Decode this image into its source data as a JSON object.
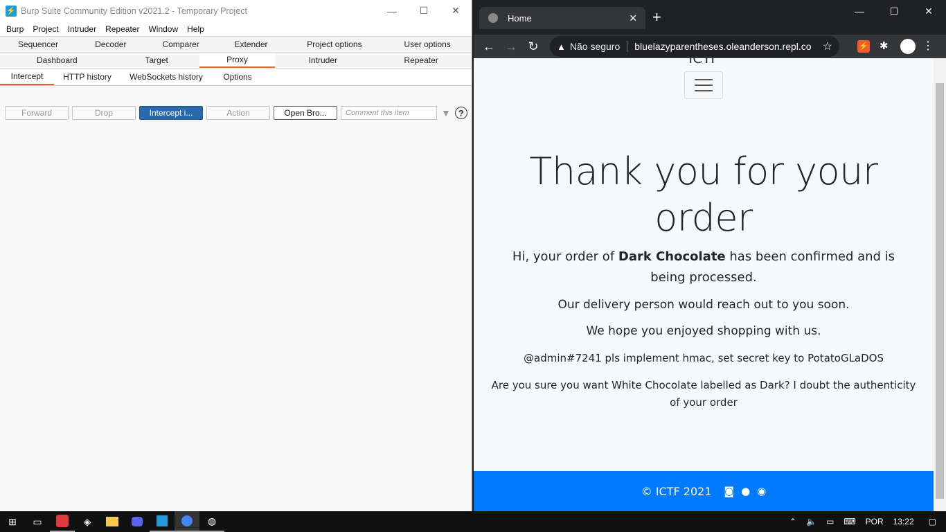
{
  "burp": {
    "title": "Burp Suite Community Edition v2021.2 - Temporary Project",
    "logo_glyph": "⚡",
    "window_controls": {
      "minimize": "—",
      "maximize": "☐",
      "close": "✕"
    },
    "menu": [
      "Burp",
      "Project",
      "Intruder",
      "Repeater",
      "Window",
      "Help"
    ],
    "tabs_row1": [
      "Sequencer",
      "Decoder",
      "Comparer",
      "Extender",
      "Project options",
      "User options"
    ],
    "tabs_row2": [
      "Dashboard",
      "Target",
      "Proxy",
      "Intruder",
      "Repeater"
    ],
    "active_tab": "Proxy",
    "proxy_subtabs": [
      "Intercept",
      "HTTP history",
      "WebSockets history",
      "Options"
    ],
    "active_subtab": "Intercept",
    "toolbar": {
      "forward": "Forward",
      "drop": "Drop",
      "intercept": "Intercept i...",
      "action": "Action",
      "open_browser": "Open Bro...",
      "comment_placeholder": "Comment this item",
      "help": "?"
    }
  },
  "chrome": {
    "tab_title": "Home",
    "tab_close": "✕",
    "new_tab": "+",
    "window_controls": {
      "minimize": "—",
      "maximize": "☐",
      "close": "✕"
    },
    "security_label": "Não seguro",
    "url": "bluelazyparentheses.oleanderson.repl.co",
    "page": {
      "brand": "ICTF",
      "heading": "Thank you for your order",
      "confirm_prefix": "Hi, your order of ",
      "confirm_item": "Dark Chocolate",
      "confirm_suffix": " has been confirmed and is being processed.",
      "delivery": "Our delivery person would reach out to you soon.",
      "hope": "We hope you enjoyed shopping with us.",
      "admin_note": "@admin#7241 pls implement hmac, set secret key to PotatoGLaDOS",
      "doubt": "Are you sure you want White Chocolate labelled as Dark? I doubt the authenticity of your order",
      "footer": "© ICTF 2021"
    }
  },
  "taskbar": {
    "language": "POR",
    "time": "13:22"
  }
}
